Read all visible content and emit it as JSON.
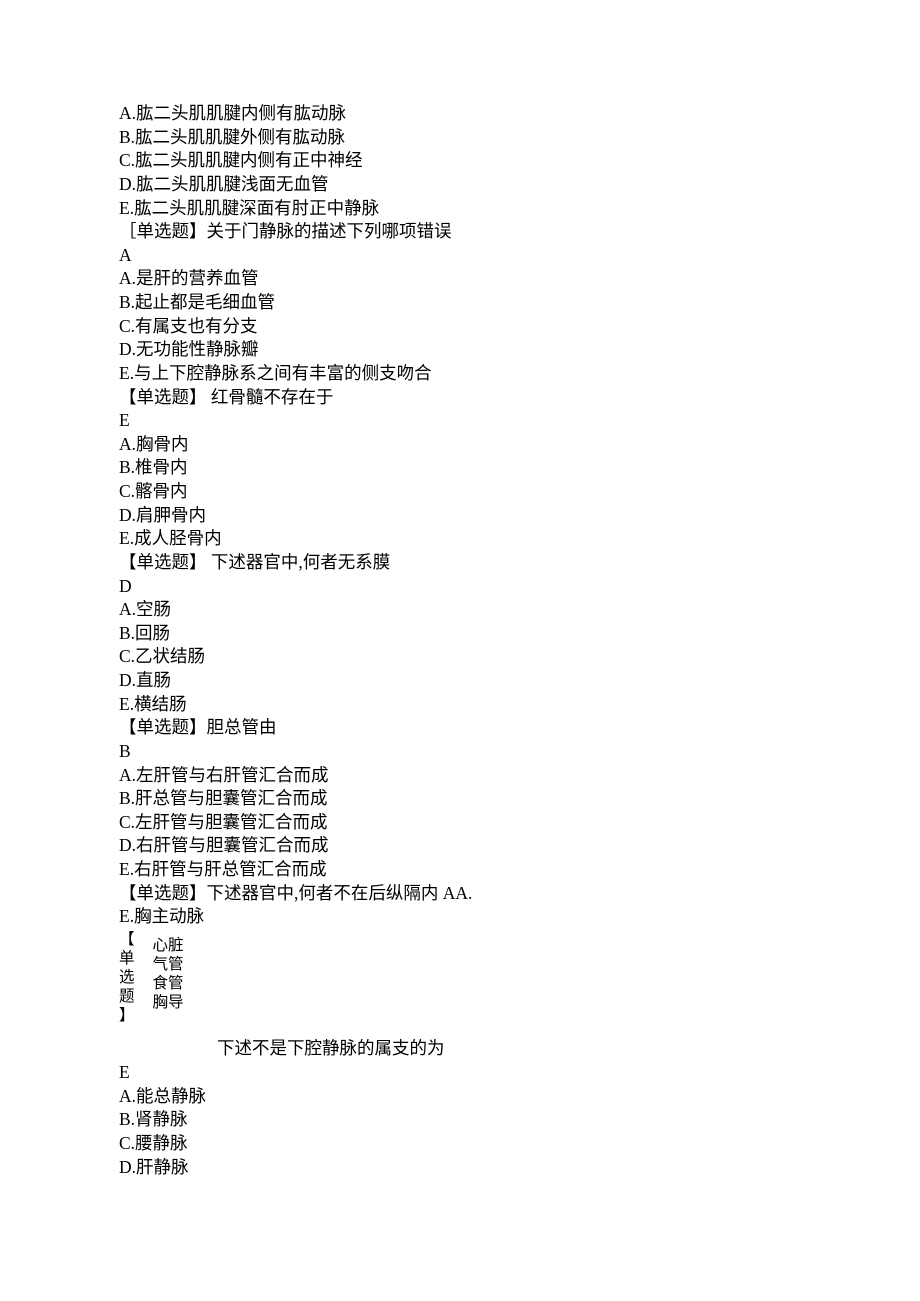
{
  "q1": {
    "A": "A.肱二头肌肌腱内侧有肱动脉",
    "B": "B.肱二头肌肌腱外侧有肱动脉",
    "C": "C.肱二头肌肌腱内侧有正中神经",
    "D": "D.肱二头肌肌腱浅面无血管",
    "E": "E.肱二头肌肌腱深面有肘正中静脉"
  },
  "q2": {
    "title": "［单选题】关于门静脉的描述下列哪项错误",
    "answer": "A",
    "A": "A.是肝的营养血管",
    "B": "B.起止都是毛细血管",
    "C": "C.有属支也有分支",
    "D": "D.无功能性静脉瓣",
    "E": "E.与上下腔静脉系之间有丰富的侧支吻合"
  },
  "q3": {
    "title": "【单选题】 红骨髓不存在于",
    "answer": "E",
    "A": "A.胸骨内",
    "B": "B.椎骨内",
    "C": "C.髂骨内",
    "D": "D.肩胛骨内",
    "E": "E.成人胫骨内"
  },
  "q4": {
    "title": "【单选题】 下述器官中,何者无系膜",
    "answer": "D",
    "A": "A.空肠",
    "B": "B.回肠",
    "C": "C.乙状结肠",
    "D": "D.直肠",
    "E": "E.横结肠"
  },
  "q5": {
    "title": "【单选题】胆总管由",
    "answer": "B",
    "A": "A.左肝管与右肝管汇合而成",
    "B": "B.肝总管与胆囊管汇合而成",
    "C": "C.左肝管与胆囊管汇合而成",
    "D": "D.右肝管与胆囊管汇合而成",
    "E": "E.右肝管与肝总管汇合而成"
  },
  "q6": {
    "title": "【单选题】下述器官中,何者不在后纵隔内 AA.",
    "E": "E.胸主动脉",
    "left": {
      "l1": "【",
      "l2": "单",
      "l3": "选",
      "l4": "题",
      "l5": "】"
    },
    "right": {
      "r1": "心脏",
      "r2": "气管",
      "r3": "食管",
      "r4": "胸导"
    }
  },
  "q7": {
    "title": "下述不是下腔静脉的属支的为",
    "answer": "E",
    "A": "A.能总静脉",
    "B": "B.肾静脉",
    "C": "C.腰静脉",
    "D": "D.肝静脉"
  }
}
